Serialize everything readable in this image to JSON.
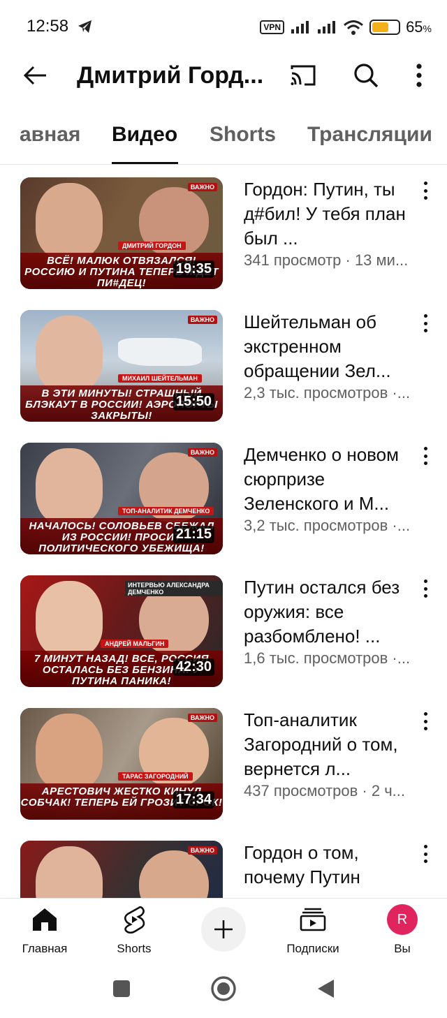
{
  "status_bar": {
    "time": "12:58",
    "vpn_label": "VPN",
    "battery_percent": "65",
    "battery_unit": "%",
    "battery_level": 0.65,
    "battery_color": "#f3b01b"
  },
  "header": {
    "title": "Дмитрий Горд...",
    "icons": [
      "back-arrow-icon",
      "cast-icon",
      "search-icon",
      "more-vertical-icon"
    ]
  },
  "tabs": [
    {
      "label": "авная",
      "active": false
    },
    {
      "label": "Видео",
      "active": true
    },
    {
      "label": "Shorts",
      "active": false
    },
    {
      "label": "Трансляции",
      "active": false
    }
  ],
  "videos": [
    {
      "title": "Гордон: Путин, ты д#бил! У тебя план был ...",
      "meta": "341 просмотр · 13 ми...",
      "duration": "19:35",
      "thumb_badge": "ВАЖНО",
      "thumb_name": "ДМИТРИЙ ГОРДОН",
      "thumb_caption": "ВСЁ! МАЛЮК ОТВЯЗАЛСЯ! РОССИЮ И ПУТИНА ТЕПЕРЬ ЖДЕТ ПИ#ДЕЦ!"
    },
    {
      "title": "Шейтельман об экстренном обращении Зел...",
      "meta": "2,3 тыс. просмотров ·...",
      "duration": "15:50",
      "thumb_badge": "ВАЖНО",
      "thumb_name": "МИХАИЛ ШЕЙТЕЛЬМАН",
      "thumb_caption": "В ЭТИ МИНУТЫ! СТРАШНЫЙ БЛЭКАУТ В РОССИИ! АЭРОПОРТЫ ЗАКРЫТЫ!"
    },
    {
      "title": "Демченко о новом сюрпризе Зеленского и М...",
      "meta": "3,2 тыс. просмотров ·...",
      "duration": "21:15",
      "thumb_badge": "ВАЖНО",
      "thumb_name": "ТОП-АНАЛИТИК ДЕМЧЕНКО",
      "thumb_caption": "НАЧАЛОСЬ! СОЛОВЬЕВ СБЕЖАЛ ИЗ РОССИИ! ПРОСИТ ПОЛИТИЧЕСКОГО УБЕЖИЩА!"
    },
    {
      "title": "Путин остался без оружия: все разбомблено! ...",
      "meta": "1,6 тыс. просмотров ·...",
      "duration": "42:30",
      "thumb_badge": "ИНТЕРВЬЮ АЛЕКСАНДРА ДЕМЧЕНКО",
      "thumb_name": "АНДРЕЙ МАЛЬГИН",
      "thumb_caption": "7 МИНУТ НАЗАД! ВСЕ, РОССИЯ ОСТАЛАСЬ БЕЗ БЕНЗИНА! У ПУТИНА ПАНИКА!"
    },
    {
      "title": "Топ-аналитик Загородний о том, вернется л...",
      "meta": "437 просмотров · 2 ч...",
      "duration": "17:34",
      "thumb_badge": "ВАЖНО",
      "thumb_name": "ТАРАС ЗАГОРОДНИЙ",
      "thumb_caption": "АРЕСТОВИЧ ЖЕСТКО КИНУЛ СОБЧАК! ТЕПЕРЬ ЕЙ ГРОЗИТ СРОК!"
    },
    {
      "title": "Гордон о том, почему Путин",
      "meta": "",
      "duration": "",
      "thumb_badge": "ВАЖНО",
      "thumb_name": "",
      "thumb_caption": ""
    }
  ],
  "bottom_nav": {
    "home_label": "Главная",
    "shorts_label": "Shorts",
    "subscriptions_label": "Подписки",
    "you_label": "Вы",
    "avatar_letter": "R",
    "avatar_color": "#e0245e"
  }
}
